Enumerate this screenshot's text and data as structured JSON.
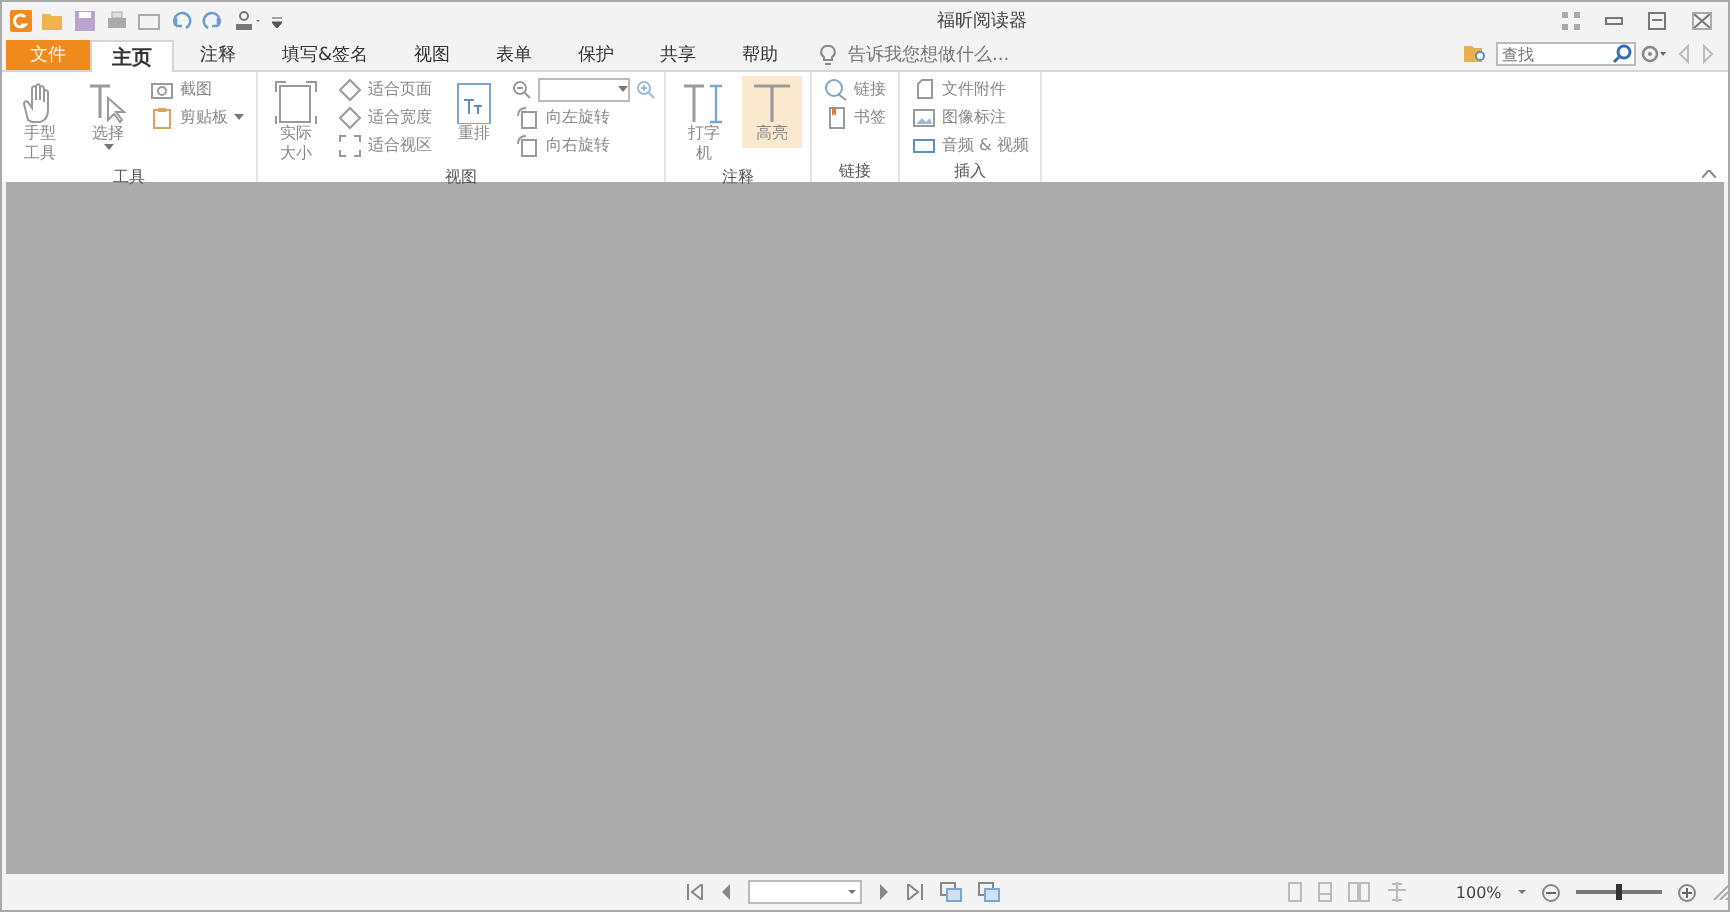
{
  "window": {
    "title": "福昕阅读器"
  },
  "tabs": [
    {
      "label": "文件",
      "kind": "file",
      "selected": false
    },
    {
      "label": "主页",
      "kind": "tab",
      "selected": true
    },
    {
      "label": "注释",
      "kind": "tab",
      "selected": false
    },
    {
      "label": "填写&签名",
      "kind": "tab",
      "selected": false
    },
    {
      "label": "视图",
      "kind": "tab",
      "selected": false
    },
    {
      "label": "表单",
      "kind": "tab",
      "selected": false
    },
    {
      "label": "保护",
      "kind": "tab",
      "selected": false
    },
    {
      "label": "共享",
      "kind": "tab",
      "selected": false
    },
    {
      "label": "帮助",
      "kind": "tab",
      "selected": false
    }
  ],
  "tell_me": {
    "placeholder": "告诉我您想做什么..."
  },
  "search": {
    "placeholder": "查找"
  },
  "ribbon": [
    {
      "label": "工具",
      "columns": [
        [
          {
            "kind": "large",
            "label": "手型工具",
            "on": false
          }
        ],
        [
          {
            "kind": "large_menu",
            "label": "选择",
            "on": false
          }
        ],
        [
          {
            "kind": "small",
            "label": "截图"
          },
          {
            "kind": "small_menu",
            "label": "剪贴板"
          }
        ]
      ]
    },
    {
      "label": "视图",
      "columns": [
        [
          {
            "kind": "large",
            "label": "实际大小",
            "on": false
          }
        ],
        [
          {
            "kind": "small",
            "label": "适合页面"
          },
          {
            "kind": "small",
            "label": "适合宽度"
          },
          {
            "kind": "small",
            "label": "适合视区"
          }
        ],
        [
          {
            "kind": "large",
            "label": "重排",
            "on": false
          }
        ],
        [
          {
            "kind": "zoom"
          },
          {
            "kind": "small",
            "label": "向左旋转"
          },
          {
            "kind": "small",
            "label": "向右旋转"
          }
        ]
      ]
    },
    {
      "label": "注释",
      "columns": [
        [
          {
            "kind": "large",
            "label": "打字机",
            "on": false
          }
        ],
        [
          {
            "kind": "large",
            "label": "高亮",
            "on": true
          }
        ]
      ]
    },
    {
      "label": "链接",
      "columns": [
        [
          {
            "kind": "small",
            "label": "链接"
          },
          {
            "kind": "small",
            "label": "书签"
          }
        ]
      ]
    },
    {
      "label": "插入",
      "columns": [
        [
          {
            "kind": "small",
            "label": "文件附件"
          },
          {
            "kind": "small",
            "label": "图像标注"
          },
          {
            "kind": "small",
            "label": "音频 & 视频"
          }
        ]
      ]
    }
  ],
  "status_bar": {
    "zoom": "100%",
    "zoom_slider": {
      "level": 0.48
    }
  }
}
